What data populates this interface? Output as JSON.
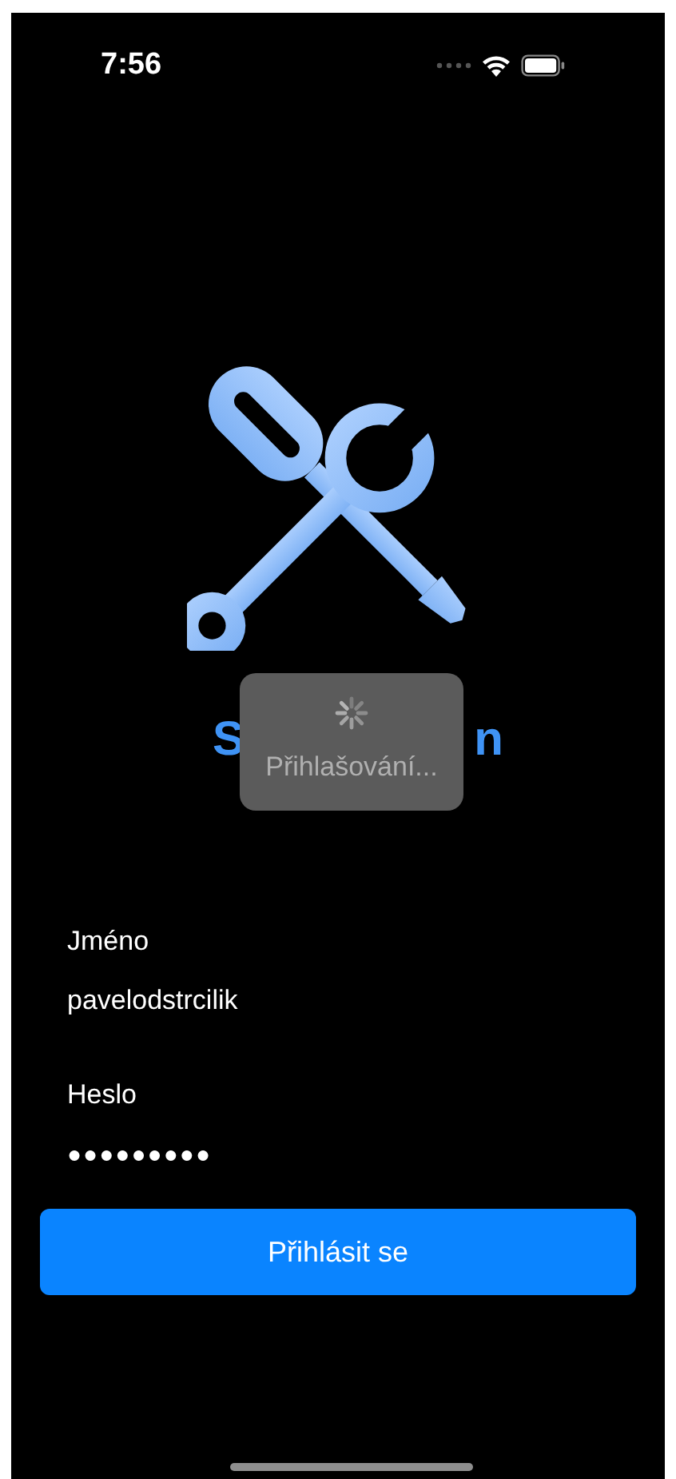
{
  "status_bar": {
    "time": "7:56"
  },
  "title": {
    "visible_start": "S",
    "visible_end": "n"
  },
  "loading": {
    "visible": true,
    "message": "Přihlašování..."
  },
  "fields": [
    {
      "label": "Jméno",
      "value": "pavelodstrcilik",
      "secure": false
    },
    {
      "label": "Heslo",
      "value": "●●●●●●●●●",
      "secure": true
    }
  ],
  "login_button": {
    "label": "Přihlásit se"
  }
}
